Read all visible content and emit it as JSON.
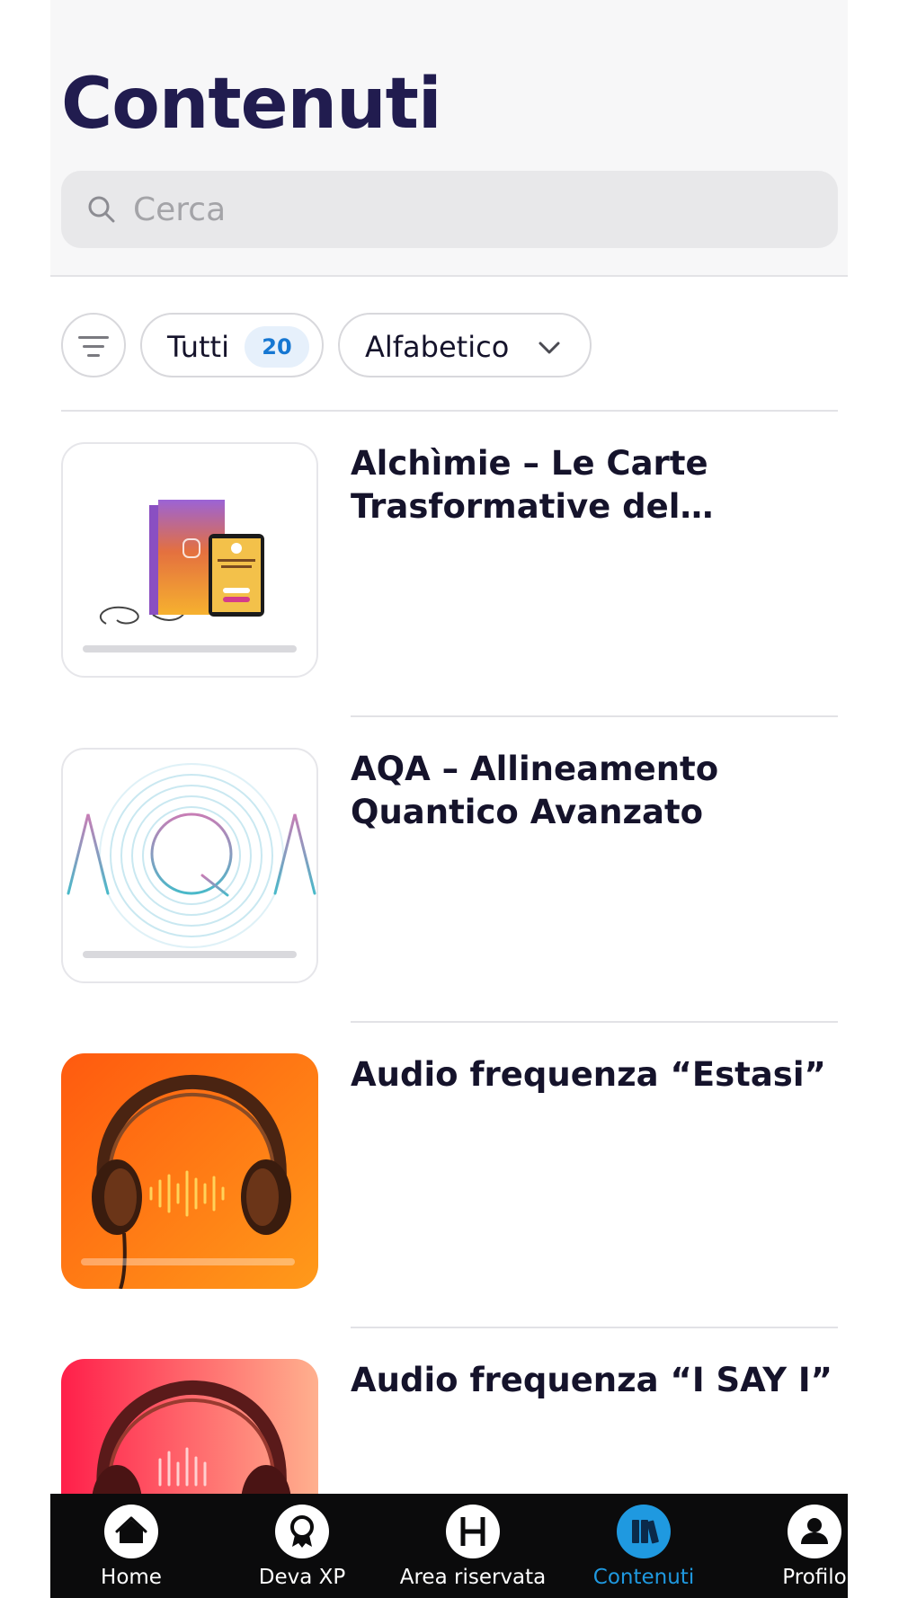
{
  "header": {
    "title": "Contenuti",
    "search_placeholder": "Cerca"
  },
  "filters": {
    "all_label": "Tutti",
    "all_count": "20",
    "sort_label": "Alfabetico"
  },
  "items": [
    {
      "title": "Alchìmie – Le Carte Trasformative del Cervello Quantico",
      "progress": 0,
      "thumb_icon": "product-box-tablet-image"
    },
    {
      "title": "AQA – Allineamento Quantico Avanzato",
      "progress": 0,
      "thumb_icon": "aqa-logo-image"
    },
    {
      "title": "Audio frequenza “Estasi”",
      "progress": 0,
      "thumb_icon": "headphones-orange-image"
    },
    {
      "title": "Audio frequenza “I SAY I”",
      "progress": 0,
      "thumb_icon": "headphones-red-image"
    }
  ],
  "tabbar": {
    "tabs": [
      {
        "label": "Home",
        "icon": "home-icon",
        "active": false
      },
      {
        "label": "Deva XP",
        "icon": "badge-icon",
        "active": false
      },
      {
        "label": "Area riservata",
        "icon": "h-letter-icon",
        "active": false
      },
      {
        "label": "Contenuti",
        "icon": "books-icon",
        "active": true
      },
      {
        "label": "Profilo",
        "icon": "user-icon",
        "active": false
      }
    ]
  },
  "colors": {
    "title": "#211c4f",
    "accent": "#1f99e0",
    "badge_bg": "#e6f0fb",
    "badge_text": "#1677d2",
    "tabbar_bg": "#0b0b0c"
  }
}
